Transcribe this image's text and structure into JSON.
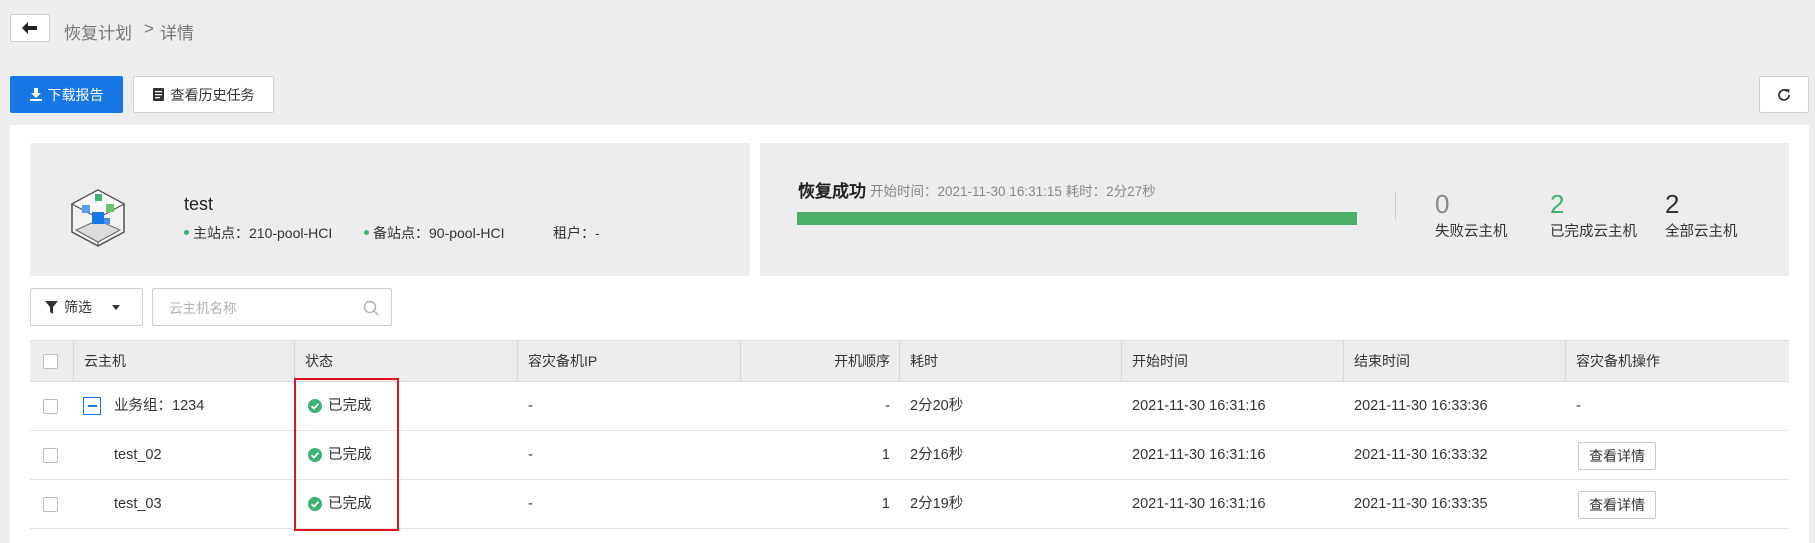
{
  "header": {
    "back_icon": "arrow-left-icon",
    "breadcrumb": {
      "parent": "恢复计划",
      "separator": ">",
      "current": "详情"
    }
  },
  "toolbar": {
    "download_label": "下载报告",
    "download_icon": "download-icon",
    "history_label": "查看历史任务",
    "history_icon": "document-icon",
    "refresh_icon": "refresh-icon"
  },
  "plan": {
    "name": "test",
    "icon": "cloud-cube-icon",
    "main_site_label": "主站点：",
    "main_site": "210-pool-HCI",
    "backup_site_label": "备站点：",
    "backup_site": "90-pool-HCI",
    "tenant_label": "租户：",
    "tenant": "-"
  },
  "status": {
    "title": "恢复成功",
    "start_label": "开始时间：",
    "start_time": "2021-11-30 16:31:15",
    "duration_label": "耗时：",
    "duration": "2分27秒",
    "progress": 1.0,
    "stats": {
      "failed": {
        "value": "0",
        "label": "失败云主机",
        "color": "#888888"
      },
      "completed": {
        "value": "2",
        "label": "已完成云主机",
        "color": "#3cb371"
      },
      "total": {
        "value": "2",
        "label": "全部云主机",
        "color": "#333333"
      }
    }
  },
  "filter": {
    "label": "筛选",
    "icon": "filter-icon",
    "search_placeholder": "云主机名称",
    "search_value": ""
  },
  "table": {
    "columns": {
      "vm": "云主机",
      "status": "状态",
      "ip": "容灾备机IP",
      "boot_order": "开机顺序",
      "duration": "耗时",
      "start": "开始时间",
      "end": "结束时间",
      "ops": "容灾备机操作"
    },
    "rows": [
      {
        "name": "业务组：1234",
        "status": "已完成",
        "ip": "-",
        "boot_order": "-",
        "duration": "2分20秒",
        "start": "2021-11-30 16:31:16",
        "end": "2021-11-30 16:33:36",
        "ops": "-"
      },
      {
        "name": "test_02",
        "status": "已完成",
        "ip": "-",
        "boot_order": "1",
        "duration": "2分16秒",
        "start": "2021-11-30 16:31:16",
        "end": "2021-11-30 16:33:32",
        "ops": "查看详情"
      },
      {
        "name": "test_03",
        "status": "已完成",
        "ip": "-",
        "boot_order": "1",
        "duration": "2分19秒",
        "start": "2021-11-30 16:31:16",
        "end": "2021-11-30 16:33:35",
        "ops": "查看详情"
      }
    ],
    "status_icon": "check-circle-icon",
    "status_color": "#3cb371"
  },
  "highlight_color": "#e0141e"
}
